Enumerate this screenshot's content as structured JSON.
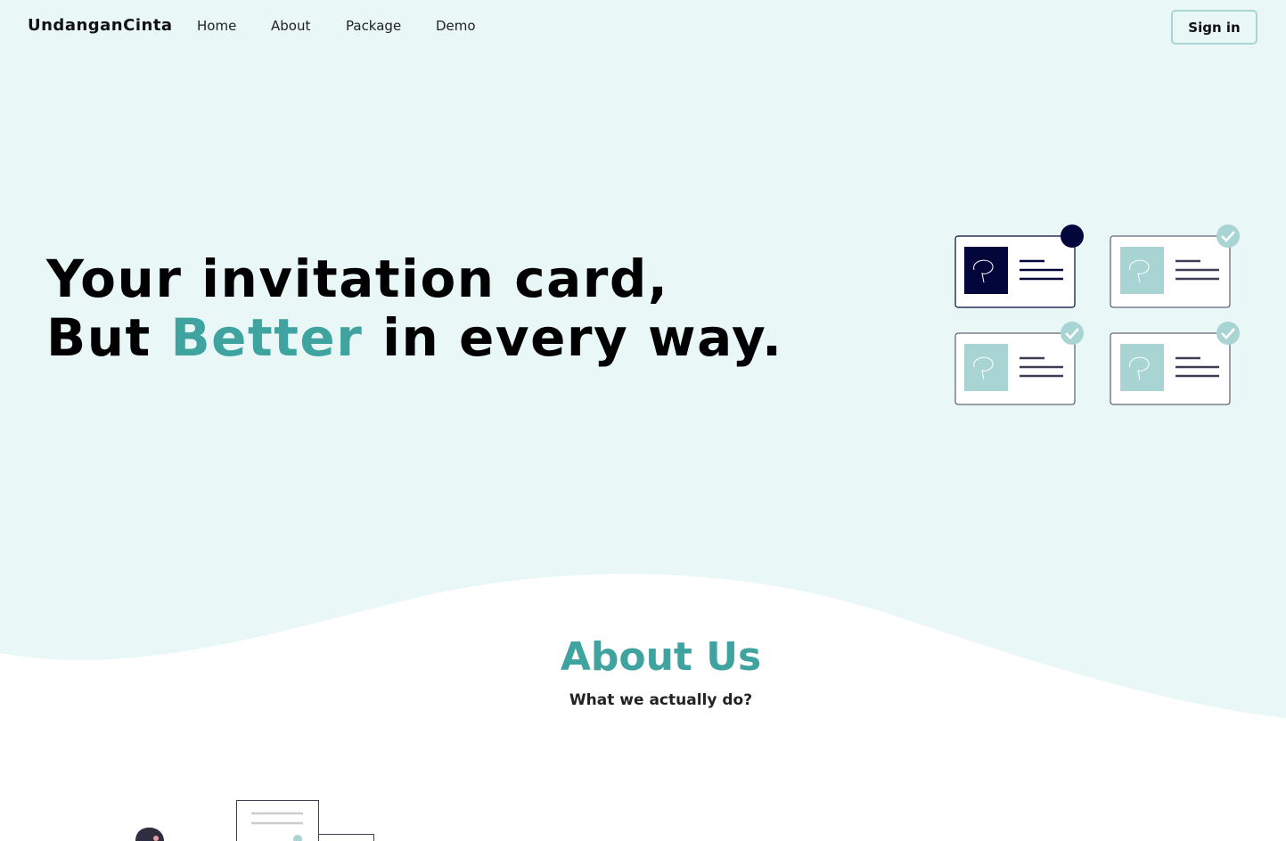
{
  "nav": {
    "brand": "UndanganCinta",
    "links": [
      "Home",
      "About",
      "Package",
      "Demo"
    ],
    "signin_label": "Sign in"
  },
  "hero": {
    "line1": "Your invitation card,",
    "line2_prefix": "But",
    "line2_accent": "Better",
    "line2_suffix": "in every way."
  },
  "about": {
    "title": "About Us",
    "subtitle": "What we actually do?"
  },
  "colors": {
    "hero_background": "#e9f7f7",
    "accent": "#3fa3a0",
    "card_selected": "#03063a",
    "card_light": "#a9d4d4"
  }
}
